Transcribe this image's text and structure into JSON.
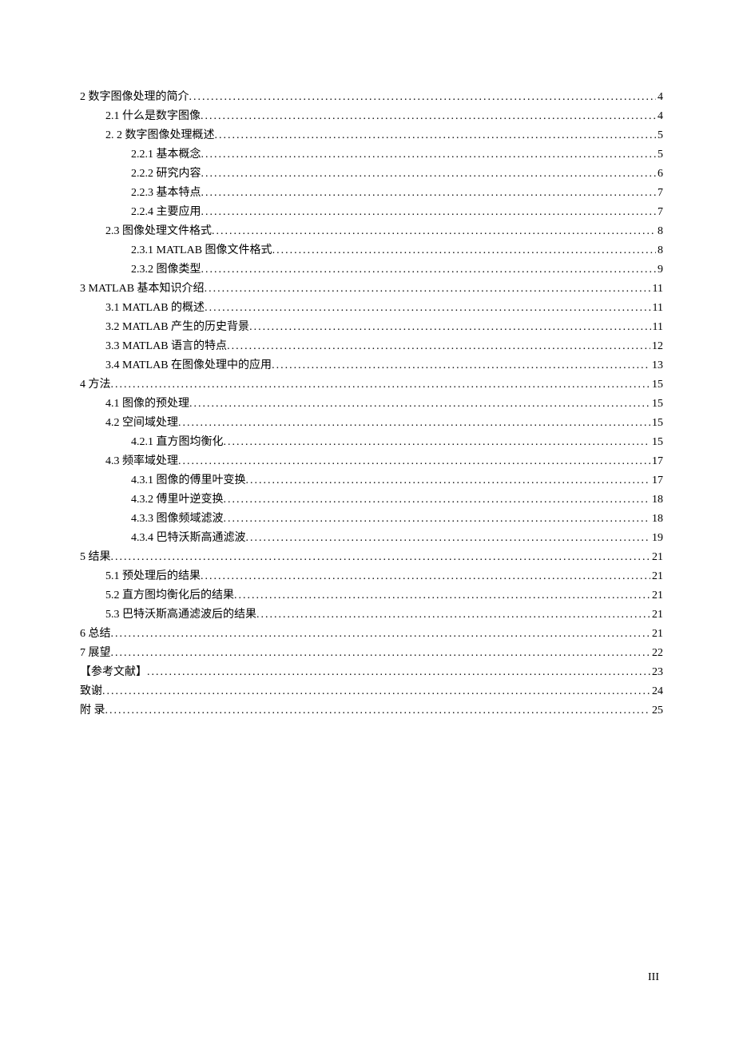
{
  "toc": [
    {
      "level": 0,
      "title": "2  数字图像处理的简介",
      "page": "4"
    },
    {
      "level": 1,
      "title": "2.1  什么是数字图像",
      "page": "4"
    },
    {
      "level": 1,
      "title": "2. 2  数字图像处理概述",
      "page": "5"
    },
    {
      "level": 2,
      "title": "2.2.1  基本概念",
      "page": "5"
    },
    {
      "level": 2,
      "title": "2.2.2  研究内容",
      "page": "6"
    },
    {
      "level": 2,
      "title": "2.2.3  基本特点",
      "page": "7"
    },
    {
      "level": 2,
      "title": "2.2.4  主要应用",
      "page": "7"
    },
    {
      "level": 1,
      "title": "2.3  图像处理文件格式",
      "page": "8"
    },
    {
      "level": 2,
      "title": "2.3.1 MATLAB 图像文件格式",
      "page": "8"
    },
    {
      "level": 2,
      "title": "2.3.2  图像类型",
      "page": "9"
    },
    {
      "level": 0,
      "title": "3 MATLAB 基本知识介绍",
      "page": "11"
    },
    {
      "level": 1,
      "title": "3.1 MATLAB 的概述",
      "page": "11"
    },
    {
      "level": 1,
      "title": "3.2 MATLAB 产生的历史背景",
      "page": "11"
    },
    {
      "level": 1,
      "title": "3.3 MATLAB 语言的特点",
      "page": "12"
    },
    {
      "level": 1,
      "title": "3.4 MATLAB 在图像处理中的应用",
      "page": "13"
    },
    {
      "level": 0,
      "title": "4  方法",
      "page": "15"
    },
    {
      "level": 1,
      "title": "4.1  图像的预处理",
      "page": "15"
    },
    {
      "level": 1,
      "title": "4.2  空间域处理",
      "page": "15"
    },
    {
      "level": 2,
      "title": "4.2.1  直方图均衡化",
      "page": "15"
    },
    {
      "level": 1,
      "title": "4.3  频率域处理",
      "page": "17"
    },
    {
      "level": 2,
      "title": "4.3.1  图像的傅里叶变换",
      "page": "17"
    },
    {
      "level": 2,
      "title": "4.3.2  傅里叶逆变换",
      "page": "18"
    },
    {
      "level": 2,
      "title": "4.3.3  图像频域滤波",
      "page": "18"
    },
    {
      "level": 2,
      "title": "4.3.4  巴特沃斯高通滤波",
      "page": "19"
    },
    {
      "level": 0,
      "title": "5  结果",
      "page": "21"
    },
    {
      "level": 1,
      "title": "5.1  预处理后的结果",
      "page": "21"
    },
    {
      "level": 1,
      "title": "5.2  直方图均衡化后的结果",
      "page": "21"
    },
    {
      "level": 1,
      "title": "5.3  巴特沃斯高通滤波后的结果",
      "page": "21"
    },
    {
      "level": 0,
      "title": "6  总结",
      "page": "21"
    },
    {
      "level": 0,
      "title": "7  展望",
      "page": "22"
    },
    {
      "level": 0,
      "title": "【参考文献】",
      "page": "23"
    },
    {
      "level": 0,
      "title": "致谢",
      "page": "24"
    },
    {
      "level": 0,
      "title": "附    录",
      "page": "25"
    }
  ],
  "page_number": "III"
}
